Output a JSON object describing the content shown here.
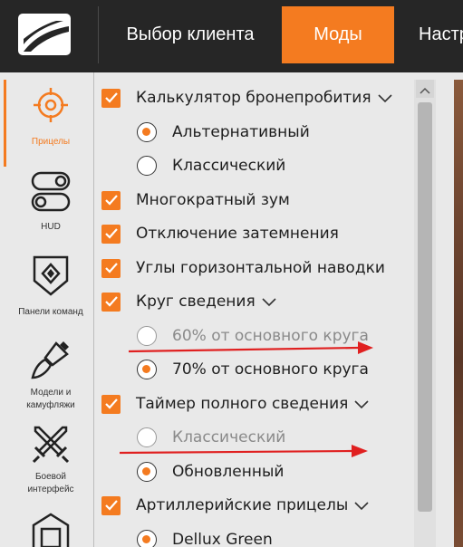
{
  "header": {
    "tabs": [
      {
        "label": "Выбор клиента"
      },
      {
        "label": "Моды"
      },
      {
        "label": "Настр"
      }
    ]
  },
  "sidebar": {
    "items": [
      {
        "label": "Прицелы",
        "icon": "crosshair-icon",
        "active": true
      },
      {
        "label": "HUD",
        "icon": "toggle-icon",
        "active": false
      },
      {
        "label": "Панели команд",
        "icon": "shield-diamond-icon",
        "active": false
      },
      {
        "label": "Модели и камуфляжи",
        "icon": "paint-brush-icon",
        "active": false
      },
      {
        "label": "Боевой интерфейс",
        "icon": "crossed-swords-icon",
        "active": false
      },
      {
        "label": "",
        "icon": "hangar-icon",
        "active": false
      }
    ]
  },
  "options": [
    {
      "type": "checkbox",
      "label": "Калькулятор бронепробития",
      "checked": true,
      "expandable": true
    },
    {
      "type": "radio",
      "label": "Альтернативный",
      "selected": true,
      "disabled": false
    },
    {
      "type": "radio",
      "label": "Классический",
      "selected": false,
      "disabled": false
    },
    {
      "type": "checkbox",
      "label": "Многократный зум",
      "checked": true
    },
    {
      "type": "checkbox",
      "label": "Отключение затемнения",
      "checked": true
    },
    {
      "type": "checkbox",
      "label": "Углы горизонтальной наводки",
      "checked": true
    },
    {
      "type": "checkbox",
      "label": "Круг сведения",
      "checked": true,
      "expandable": true
    },
    {
      "type": "radio",
      "label": "60% от основного круга",
      "selected": false,
      "disabled": true
    },
    {
      "type": "radio",
      "label": "70% от основного круга",
      "selected": true,
      "disabled": false
    },
    {
      "type": "checkbox",
      "label": "Таймер полного сведения",
      "checked": true,
      "expandable": true
    },
    {
      "type": "radio",
      "label": "Классический",
      "selected": false,
      "disabled": true
    },
    {
      "type": "radio",
      "label": "Обновленный",
      "selected": true,
      "disabled": false
    },
    {
      "type": "checkbox",
      "label": "Артиллерийские прицелы",
      "checked": true,
      "expandable": true
    },
    {
      "type": "radio",
      "label": "Dellux Green",
      "selected": true,
      "disabled": false
    }
  ],
  "colors": {
    "accent": "#f47b20",
    "topbar": "#262626",
    "background": "#e9e9e9",
    "arrow": "#e02020"
  }
}
